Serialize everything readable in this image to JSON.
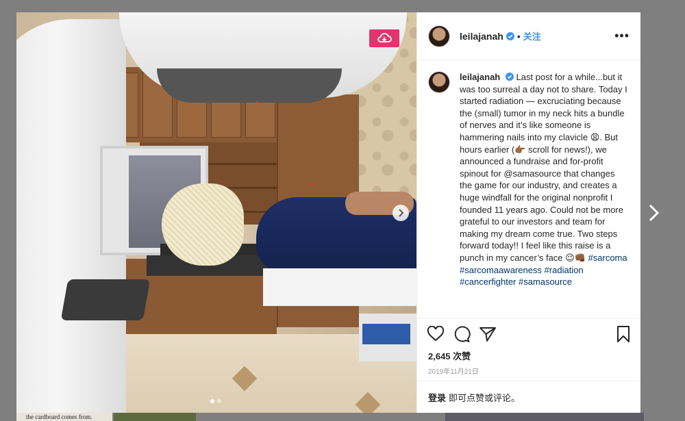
{
  "post": {
    "username": "leilajanah",
    "follow_label": "关注",
    "separator": "•",
    "more_label": "•••",
    "caption_user": "leilajanah",
    "caption_text": "Last post for a while...but it was too surreal a day not to share. Today I started radiation — excruciating because the (small) tumor in my neck hits a bundle of nerves and it’s like someone is hammering nails into my clavicle 😩. But hours earlier (👉🏾 scroll for news!), we announced a fundraise and for-profit spinout for @samasource that changes the game for our industry, and creates a huge windfall for the original nonprofit I founded 11 years ago. Could not be more grateful to our investors and team for making my dream come true. Two steps forward today!! I feel like this raise is a punch in my cancer’s face 😉👊🏾",
    "hashtags": "#sarcoma #sarcomaawareness #radiation #cancerfighter #samasource",
    "likes": "2,645 次赞",
    "date": "2019年11月21日",
    "login_link": "登录",
    "login_rest": "即可点赞或评论。"
  },
  "background": {
    "snippet": "the cardboard comes from."
  },
  "colors": {
    "save_badge": "#e0356f",
    "link_blue": "#3897f0",
    "hashtag": "#003569"
  },
  "icons": [
    "verified-icon",
    "more-icon",
    "heart-icon",
    "comment-icon",
    "share-icon",
    "bookmark-icon",
    "cloud-save-icon",
    "chevron-right-icon"
  ]
}
